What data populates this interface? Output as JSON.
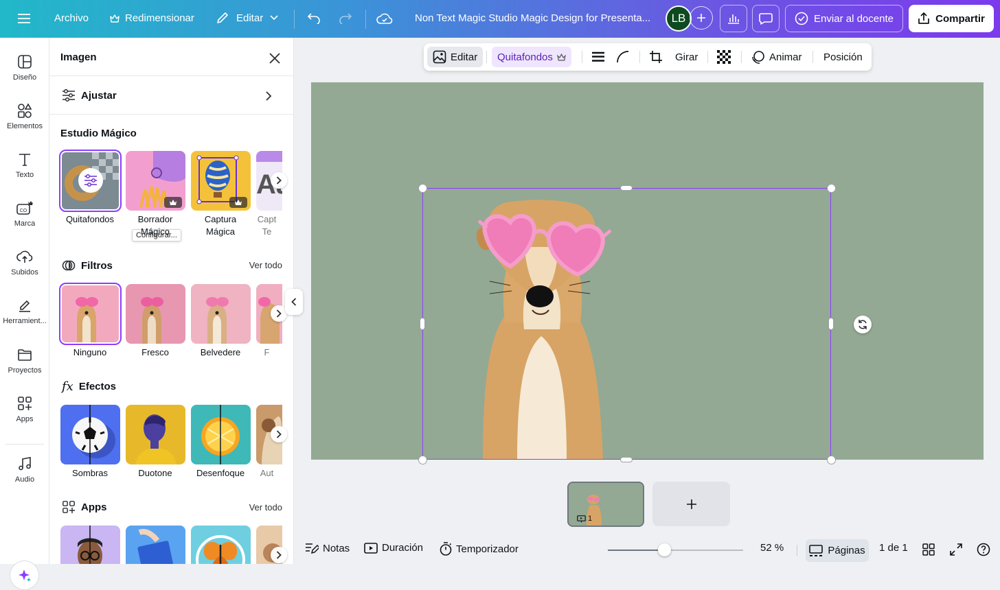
{
  "topbar": {
    "menu_label": "",
    "file": "Archivo",
    "resize": "Redimensionar",
    "edit": "Editar",
    "doc_title": "Non Text Magic Studio Magic Design for Presenta...",
    "avatar": "LB",
    "send_teacher": "Enviar al docente",
    "share": "Compartir"
  },
  "rail": [
    {
      "label": "Diseño",
      "icon": "layout-icon"
    },
    {
      "label": "Elementos",
      "icon": "shapes-icon"
    },
    {
      "label": "Texto",
      "icon": "text-icon"
    },
    {
      "label": "Marca",
      "icon": "brand-icon"
    },
    {
      "label": "Subidos",
      "icon": "cloud-upload-icon"
    },
    {
      "label": "Herramient...",
      "icon": "draw-tool-icon"
    },
    {
      "label": "Proyectos",
      "icon": "folder-icon"
    },
    {
      "label": "Apps",
      "icon": "apps-icon"
    },
    {
      "label": "Audio",
      "icon": "music-icon"
    }
  ],
  "panel": {
    "title": "Imagen",
    "adjust": "Ajustar",
    "magic_title": "Estudio Mágico",
    "magic_tiles": [
      "Quitafondos",
      "Borrador\nMágico",
      "Captura\nMágica",
      "Capt\nTe"
    ],
    "tooltip": "Configurar...",
    "filters_title": "Filtros",
    "see_all": "Ver todo",
    "filters": [
      "Ninguno",
      "Fresco",
      "Belvedere",
      "F"
    ],
    "effects_title": "Efectos",
    "effects": [
      "Sombras",
      "Duotone",
      "Desenfoque",
      "Aut"
    ],
    "apps_title": "Apps",
    "apps_see_all": "Ver todo"
  },
  "ctx_toolbar": {
    "edit": "Editar",
    "bg_remover": "Quitafondos",
    "rotate": "Girar",
    "animate": "Animar",
    "position": "Posición"
  },
  "pages": {
    "current_number": "1"
  },
  "bottombar": {
    "notes": "Notas",
    "duration": "Duración",
    "timer": "Temporizador",
    "zoom": "52 %",
    "zoom_fraction": 0.42,
    "pages": "Páginas",
    "page_count": "1 de 1"
  },
  "colors": {
    "accent": "#8b3dff",
    "canvas_bg": "#93a993"
  }
}
